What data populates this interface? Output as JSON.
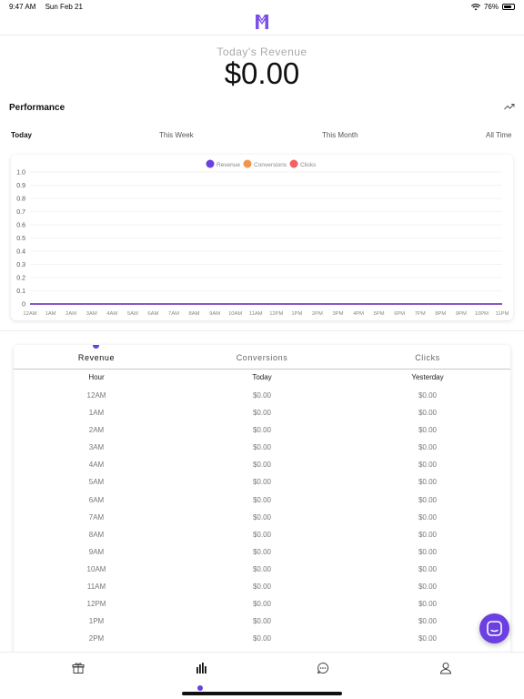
{
  "status": {
    "time": "9:47 AM",
    "date": "Sun Feb 21",
    "battery_text": "76%",
    "battery_level": 0.76
  },
  "header": {
    "logo_icon": "brand-m-logo-icon"
  },
  "revenue": {
    "label": "Today's Revenue",
    "value": "$0.00"
  },
  "performance": {
    "title": "Performance",
    "trend_icon": "trending-up-icon",
    "periods": [
      "Today",
      "This Week",
      "This Month",
      "All Time"
    ],
    "active_period": 0
  },
  "chart_data": {
    "type": "line",
    "x": [
      "12AM",
      "1AM",
      "2AM",
      "3AM",
      "4AM",
      "5AM",
      "6AM",
      "7AM",
      "8AM",
      "9AM",
      "10AM",
      "11AM",
      "12PM",
      "1PM",
      "2PM",
      "3PM",
      "4PM",
      "5PM",
      "6PM",
      "7PM",
      "8PM",
      "9PM",
      "10PM",
      "11PM"
    ],
    "series": [
      {
        "name": "Revenue",
        "color": "#6b3fe0",
        "values": [
          0,
          0,
          0,
          0,
          0,
          0,
          0,
          0,
          0,
          0,
          0,
          0,
          0,
          0,
          0,
          0,
          0,
          0,
          0,
          0,
          0,
          0,
          0,
          0
        ]
      },
      {
        "name": "Conversions",
        "color": "#f0954a",
        "values": [
          0,
          0,
          0,
          0,
          0,
          0,
          0,
          0,
          0,
          0,
          0,
          0,
          0,
          0,
          0,
          0,
          0,
          0,
          0,
          0,
          0,
          0,
          0,
          0
        ]
      },
      {
        "name": "Clicks",
        "color": "#f06262",
        "values": [
          0,
          0,
          0,
          0,
          0,
          0,
          0,
          0,
          0,
          0,
          0,
          0,
          0,
          0,
          0,
          0,
          0,
          0,
          0,
          0,
          0,
          0,
          0,
          0
        ]
      }
    ],
    "y_ticks": [
      "0",
      "0.1",
      "0.2",
      "0.3",
      "0.4",
      "0.5",
      "0.6",
      "0.7",
      "0.8",
      "0.9",
      "1.0"
    ],
    "ylim": [
      0,
      1
    ],
    "grid": true,
    "legend_position": "top-center",
    "baseline_color": "#4fc3e0"
  },
  "metrics": {
    "tabs": [
      "Revenue",
      "Conversions",
      "Clicks"
    ],
    "active_tab": 0
  },
  "table": {
    "headers": [
      "Hour",
      "Today",
      "Yesterday"
    ],
    "rows": [
      [
        "12AM",
        "$0.00",
        "$0.00"
      ],
      [
        "1AM",
        "$0.00",
        "$0.00"
      ],
      [
        "2AM",
        "$0.00",
        "$0.00"
      ],
      [
        "3AM",
        "$0.00",
        "$0.00"
      ],
      [
        "4AM",
        "$0.00",
        "$0.00"
      ],
      [
        "5AM",
        "$0.00",
        "$0.00"
      ],
      [
        "6AM",
        "$0.00",
        "$0.00"
      ],
      [
        "7AM",
        "$0.00",
        "$0.00"
      ],
      [
        "8AM",
        "$0.00",
        "$0.00"
      ],
      [
        "9AM",
        "$0.00",
        "$0.00"
      ],
      [
        "10AM",
        "$0.00",
        "$0.00"
      ],
      [
        "11AM",
        "$0.00",
        "$0.00"
      ],
      [
        "12PM",
        "$0.00",
        "$0.00"
      ],
      [
        "1PM",
        "$0.00",
        "$0.00"
      ],
      [
        "2PM",
        "$0.00",
        "$0.00"
      ]
    ]
  },
  "tab_bar": {
    "items": [
      "gift-icon",
      "bar-chart-icon",
      "chat-bubble-icon",
      "profile-icon"
    ],
    "active": 1
  },
  "chat_fab": {
    "icon": "messenger-chat-icon",
    "color": "#6b3fe0"
  }
}
